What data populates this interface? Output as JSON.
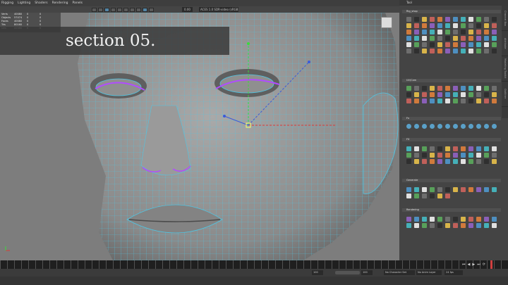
{
  "app": {
    "menus": [
      "Rigging",
      "Lighting",
      "Shaders",
      "Rendering",
      "Panels"
    ]
  },
  "viewport": {
    "coord_readout": "0.00",
    "color_space": "ACES 1.0 SDR-video (sRGB)",
    "stats_rows": [
      [
        "Verts",
        "40080",
        "0",
        "0"
      ],
      [
        "Objects",
        "57474",
        "0",
        "0"
      ],
      [
        "Faces",
        "40080",
        "0",
        "0"
      ],
      [
        "Tris",
        "80160",
        "0",
        "0"
      ],
      [
        "UVs",
        "41580",
        "0",
        "0"
      ]
    ],
    "section_title": "section 05.",
    "axis_colors": {
      "x": "#d93b3b",
      "y": "#3bd93b",
      "z": "#3b5bd9"
    },
    "mesh_color": "#4ec7e6",
    "highlight_color": "#b14cff"
  },
  "right_panel": {
    "shelf_header": "Tool",
    "sections": [
      {
        "label": "Rig_shop"
      },
      {
        "label": "UV/Cam"
      },
      {
        "label": "Fx"
      },
      {
        "label": "FX"
      },
      {
        "label": "Generate"
      },
      {
        "label": "Rendering"
      }
    ],
    "vertical_tabs": [
      "Channel Box",
      "Attribute",
      "Modeling Toolkit",
      "Outliner"
    ]
  },
  "timeline": {
    "start_frame": "1",
    "end_frame": "120",
    "current": "1",
    "range_start": "100",
    "range_end": "100",
    "character_set": "No Character Set",
    "anim_layer": "No Anim Layer",
    "fps": "24 fps",
    "play_controls": [
      "⏮",
      "◀",
      "▶",
      "⏭",
      "⟳"
    ]
  }
}
